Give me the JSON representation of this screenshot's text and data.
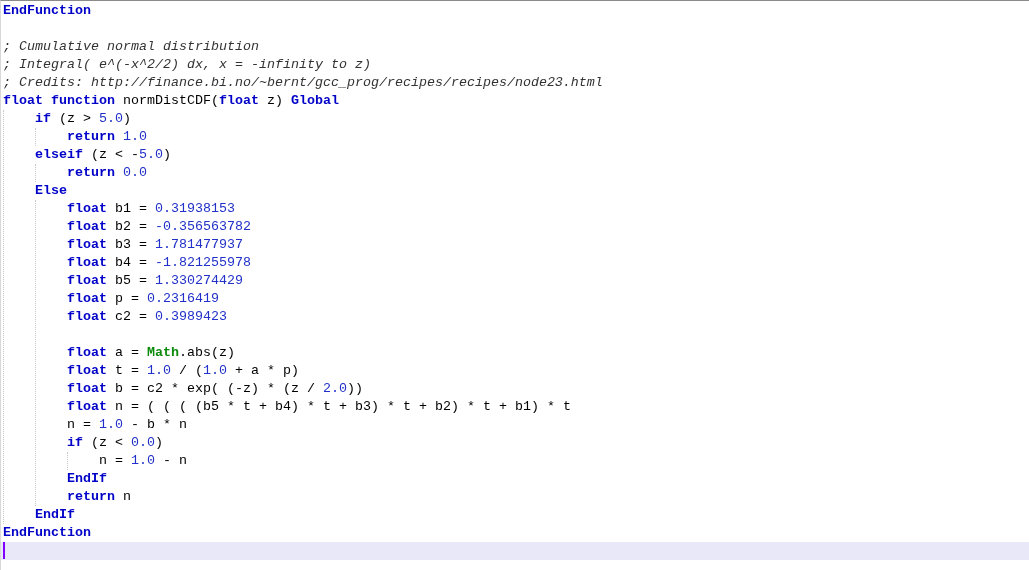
{
  "lines": [
    {
      "kind": "code",
      "current": false,
      "tokens": [
        {
          "kind": "keyword",
          "text": "EndFunction"
        }
      ]
    },
    {
      "kind": "blank",
      "current": false
    },
    {
      "kind": "code",
      "current": false,
      "tokens": [
        {
          "kind": "comment",
          "text": "; Cumulative normal distribution"
        }
      ]
    },
    {
      "kind": "code",
      "current": false,
      "tokens": [
        {
          "kind": "comment",
          "text": "; Integral( e^(-x^2/2) dx, x = -infinity to z)"
        }
      ]
    },
    {
      "kind": "code",
      "current": false,
      "tokens": [
        {
          "kind": "comment",
          "text": "; Credits: http://finance.bi.no/~bernt/gcc_prog/recipes/recipes/node23.html"
        }
      ]
    },
    {
      "kind": "code",
      "current": false,
      "tokens": [
        {
          "kind": "keyword",
          "text": "float function"
        },
        {
          "kind": "plain",
          "text": " normDistCDF("
        },
        {
          "kind": "keyword",
          "text": "float"
        },
        {
          "kind": "plain",
          "text": " z) "
        },
        {
          "kind": "keyword",
          "text": "Global"
        }
      ],
      "children": [
        {
          "kind": "code",
          "current": false,
          "tokens": [
            {
              "kind": "keyword",
              "text": "if"
            },
            {
              "kind": "plain",
              "text": " (z > "
            },
            {
              "kind": "number",
              "text": "5.0"
            },
            {
              "kind": "plain",
              "text": ")"
            }
          ],
          "children": [
            {
              "kind": "code",
              "current": false,
              "tokens": [
                {
                  "kind": "keyword",
                  "text": "return"
                },
                {
                  "kind": "number",
                  "text": " 1.0"
                }
              ]
            }
          ]
        },
        {
          "kind": "code",
          "current": false,
          "tokens": [
            {
              "kind": "keyword",
              "text": "elseif"
            },
            {
              "kind": "plain",
              "text": " (z < -"
            },
            {
              "kind": "number",
              "text": "5.0"
            },
            {
              "kind": "plain",
              "text": ")"
            }
          ],
          "children": [
            {
              "kind": "code",
              "current": false,
              "tokens": [
                {
                  "kind": "keyword",
                  "text": "return"
                },
                {
                  "kind": "number",
                  "text": " 0.0"
                }
              ]
            }
          ]
        },
        {
          "kind": "code",
          "current": false,
          "tokens": [
            {
              "kind": "keyword",
              "text": "Else"
            }
          ],
          "children": [
            {
              "kind": "code",
              "current": false,
              "tokens": [
                {
                  "kind": "keyword",
                  "text": "float"
                },
                {
                  "kind": "plain",
                  "text": " b1 = "
                },
                {
                  "kind": "number",
                  "text": "0.31938153"
                }
              ]
            },
            {
              "kind": "code",
              "current": false,
              "tokens": [
                {
                  "kind": "keyword",
                  "text": "float"
                },
                {
                  "kind": "plain",
                  "text": " b2 = "
                },
                {
                  "kind": "number",
                  "text": "-0.356563782"
                }
              ]
            },
            {
              "kind": "code",
              "current": false,
              "tokens": [
                {
                  "kind": "keyword",
                  "text": "float"
                },
                {
                  "kind": "plain",
                  "text": " b3 = "
                },
                {
                  "kind": "number",
                  "text": "1.781477937"
                }
              ]
            },
            {
              "kind": "code",
              "current": false,
              "tokens": [
                {
                  "kind": "keyword",
                  "text": "float"
                },
                {
                  "kind": "plain",
                  "text": " b4 = "
                },
                {
                  "kind": "number",
                  "text": "-1.821255978"
                }
              ]
            },
            {
              "kind": "code",
              "current": false,
              "tokens": [
                {
                  "kind": "keyword",
                  "text": "float"
                },
                {
                  "kind": "plain",
                  "text": " b5 = "
                },
                {
                  "kind": "number",
                  "text": "1.330274429"
                }
              ]
            },
            {
              "kind": "code",
              "current": false,
              "tokens": [
                {
                  "kind": "keyword",
                  "text": "float"
                },
                {
                  "kind": "plain",
                  "text": " p = "
                },
                {
                  "kind": "number",
                  "text": "0.2316419"
                }
              ]
            },
            {
              "kind": "code",
              "current": false,
              "tokens": [
                {
                  "kind": "keyword",
                  "text": "float"
                },
                {
                  "kind": "plain",
                  "text": " c2 = "
                },
                {
                  "kind": "number",
                  "text": "0.3989423"
                }
              ]
            },
            {
              "kind": "blank",
              "current": false
            },
            {
              "kind": "code",
              "current": false,
              "tokens": [
                {
                  "kind": "keyword",
                  "text": "float"
                },
                {
                  "kind": "plain",
                  "text": " a = "
                },
                {
                  "kind": "class",
                  "text": "Math"
                },
                {
                  "kind": "plain",
                  "text": ".abs(z)"
                }
              ]
            },
            {
              "kind": "code",
              "current": false,
              "tokens": [
                {
                  "kind": "keyword",
                  "text": "float"
                },
                {
                  "kind": "plain",
                  "text": " t = "
                },
                {
                  "kind": "number",
                  "text": "1.0"
                },
                {
                  "kind": "plain",
                  "text": " / ("
                },
                {
                  "kind": "number",
                  "text": "1.0"
                },
                {
                  "kind": "plain",
                  "text": " + a * p)"
                }
              ]
            },
            {
              "kind": "code",
              "current": false,
              "tokens": [
                {
                  "kind": "keyword",
                  "text": "float"
                },
                {
                  "kind": "plain",
                  "text": " b = c2 * exp( (-z) * (z / "
                },
                {
                  "kind": "number",
                  "text": "2.0"
                },
                {
                  "kind": "plain",
                  "text": "))"
                }
              ]
            },
            {
              "kind": "code",
              "current": false,
              "tokens": [
                {
                  "kind": "keyword",
                  "text": "float"
                },
                {
                  "kind": "plain",
                  "text": " n = ( ( ( (b5 * t + b4) * t + b3) * t + b2) * t + b1) * t"
                }
              ]
            },
            {
              "kind": "code",
              "current": false,
              "tokens": [
                {
                  "kind": "plain",
                  "text": "n = "
                },
                {
                  "kind": "number",
                  "text": "1.0"
                },
                {
                  "kind": "plain",
                  "text": " - b * n"
                }
              ]
            },
            {
              "kind": "code",
              "current": false,
              "tokens": [
                {
                  "kind": "keyword",
                  "text": "if"
                },
                {
                  "kind": "plain",
                  "text": " (z < "
                },
                {
                  "kind": "number",
                  "text": "0.0"
                },
                {
                  "kind": "plain",
                  "text": ")"
                }
              ],
              "children": [
                {
                  "kind": "code",
                  "current": false,
                  "tokens": [
                    {
                      "kind": "plain",
                      "text": "n = "
                    },
                    {
                      "kind": "number",
                      "text": "1.0"
                    },
                    {
                      "kind": "plain",
                      "text": " - n"
                    }
                  ]
                }
              ]
            },
            {
              "kind": "code",
              "current": false,
              "tokens": [
                {
                  "kind": "keyword",
                  "text": "EndIf"
                }
              ]
            },
            {
              "kind": "code",
              "current": false,
              "tokens": [
                {
                  "kind": "keyword",
                  "text": "return"
                },
                {
                  "kind": "plain",
                  "text": " n"
                }
              ]
            }
          ]
        },
        {
          "kind": "code",
          "current": false,
          "tokens": [
            {
              "kind": "keyword",
              "text": "EndIf"
            }
          ]
        }
      ]
    },
    {
      "kind": "code",
      "current": false,
      "tokens": [
        {
          "kind": "keyword",
          "text": "EndFunction"
        }
      ]
    },
    {
      "kind": "blank",
      "current": true
    }
  ]
}
